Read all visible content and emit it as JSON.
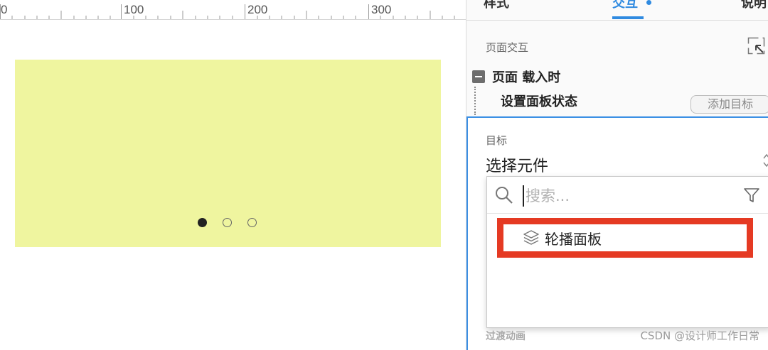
{
  "ruler": {
    "labels": [
      "0",
      "100",
      "200",
      "300"
    ]
  },
  "carousel": {
    "background_color": "#eff59f",
    "slide_count": 3,
    "active_index": 0
  },
  "panel": {
    "tabs": [
      {
        "label": "样式",
        "active": false
      },
      {
        "label": "交互",
        "active": true
      },
      {
        "label": "说明",
        "active": false
      }
    ],
    "section_title": "页面交互",
    "event": {
      "label": "页面 载入时",
      "collapse_icon": "minus-square-icon"
    },
    "action": {
      "label": "设置面板状态"
    },
    "add_target_label": "添加目标",
    "target": {
      "label": "目标",
      "select_value": "选择元件",
      "search": {
        "placeholder": "搜索...",
        "value": ""
      },
      "results": [
        {
          "label": "轮播面板",
          "icon": "layers-icon"
        }
      ],
      "bottom_faded_text": "过渡动画"
    }
  },
  "watermark": "CSDN @设计师工作日常",
  "colors": {
    "accent": "#2f8ae0",
    "highlight": "#e53a23",
    "canvas_panel": "#eff59f"
  }
}
